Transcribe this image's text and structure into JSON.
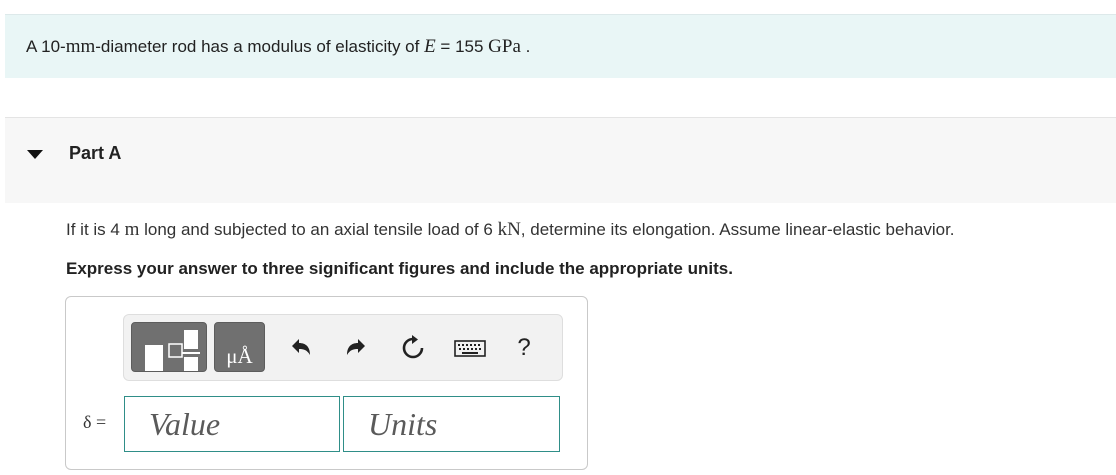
{
  "intro": {
    "text_before": "A 10-",
    "math_unit": "mm",
    "text_middle": "-diameter rod has a modulus of elasticity of ",
    "math_var": "E",
    "text_equals": " = 155 ",
    "math_gpa": "GPa",
    "text_end": " ."
  },
  "part": {
    "title": "Part A",
    "question": {
      "t1": "If it is 4 ",
      "m1": "m",
      "t2": " long and subjected to an axial tensile load of 6 ",
      "m2": "kN",
      "t3": ", determine its elongation. Assume linear-elastic behavior."
    },
    "instruction": "Express your answer to three significant figures and include the appropriate units."
  },
  "toolbar": {
    "buttons": [
      "templates-button",
      "units-button",
      "undo-button",
      "redo-button",
      "reset-button",
      "keyboard-button",
      "help-button"
    ],
    "help_label": "?",
    "units_glyph": "μÅ"
  },
  "answer": {
    "label": "δ =",
    "value_placeholder": "Value",
    "units_placeholder": "Units"
  }
}
